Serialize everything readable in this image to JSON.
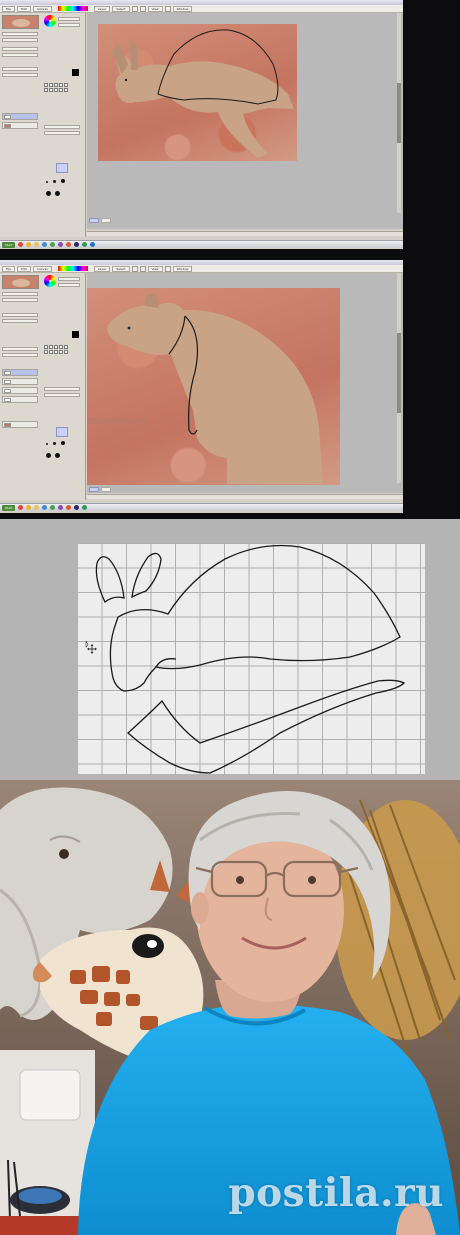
{
  "screenshot_1": {
    "menus": [
      "File",
      "Edit",
      "Canvas",
      "Layer",
      "Select",
      "View",
      "Window"
    ],
    "taskbar": {
      "start_label": "Start"
    }
  },
  "screenshot_2": {
    "menus": [
      "File",
      "Edit",
      "Canvas",
      "Layer",
      "Select",
      "View",
      "Window"
    ],
    "taskbar": {
      "start_label": "Start"
    }
  },
  "watermark": {
    "text": "postila.ru"
  },
  "colors": {
    "app_chrome": "#d4d0c8",
    "canvas_bg": "#b9b9b9",
    "kangaroo_fur": "#c9a386",
    "outline": "#1a1a1a",
    "shirt": "#14a3e6",
    "selected_tab": "#c7d2f0"
  },
  "icons": [
    "menu-icon",
    "color-wheel-icon",
    "layer-thumbnail-icon",
    "start-orb-icon",
    "browser-icon",
    "folder-icon",
    "paint-tool-icon",
    "move-cursor-icon"
  ]
}
